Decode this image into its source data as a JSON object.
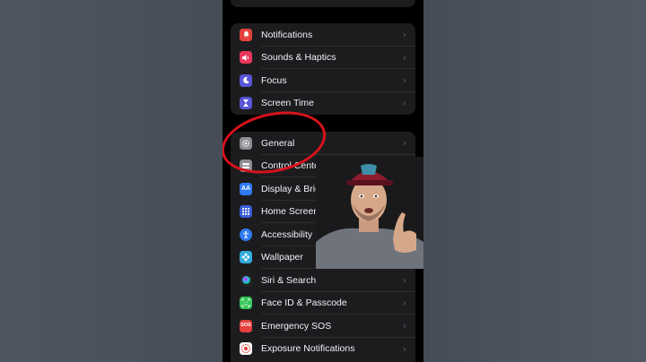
{
  "groups": [
    {
      "items": [
        {
          "label": "Notifications",
          "icon": "bell-icon",
          "color": "#e5413c"
        },
        {
          "label": "Sounds & Haptics",
          "icon": "speaker-icon",
          "color": "#e9365a"
        },
        {
          "label": "Focus",
          "icon": "moon-icon",
          "color": "#5856d6"
        },
        {
          "label": "Screen Time",
          "icon": "hourglass-icon",
          "color": "#5856d6"
        }
      ]
    },
    {
      "items": [
        {
          "label": "General",
          "icon": "gear-icon",
          "color": "#8e8e93"
        },
        {
          "label": "Control Center",
          "icon": "switches-icon",
          "color": "#8e8e93"
        },
        {
          "label": "Display & Brightness",
          "icon": "text-size-icon",
          "color": "#2f7bf5"
        },
        {
          "label": "Home Screen",
          "icon": "grid-icon",
          "color": "#3a5bd8"
        },
        {
          "label": "Accessibility",
          "icon": "accessibility-icon",
          "color": "#2f7bf5"
        },
        {
          "label": "Wallpaper",
          "icon": "flower-icon",
          "color": "#34aadc"
        },
        {
          "label": "Siri & Search",
          "icon": "siri-icon",
          "color": "#222"
        },
        {
          "label": "Face ID & Passcode",
          "icon": "face-id-icon",
          "color": "#34c759"
        },
        {
          "label": "Emergency SOS",
          "icon": "sos-icon",
          "color": "#e5413c"
        },
        {
          "label": "Exposure Notifications",
          "icon": "exposure-icon",
          "color": "#e5413c"
        }
      ]
    }
  ],
  "icon_text": {
    "display": "AA",
    "sos": "SOS"
  },
  "chevron": "›"
}
